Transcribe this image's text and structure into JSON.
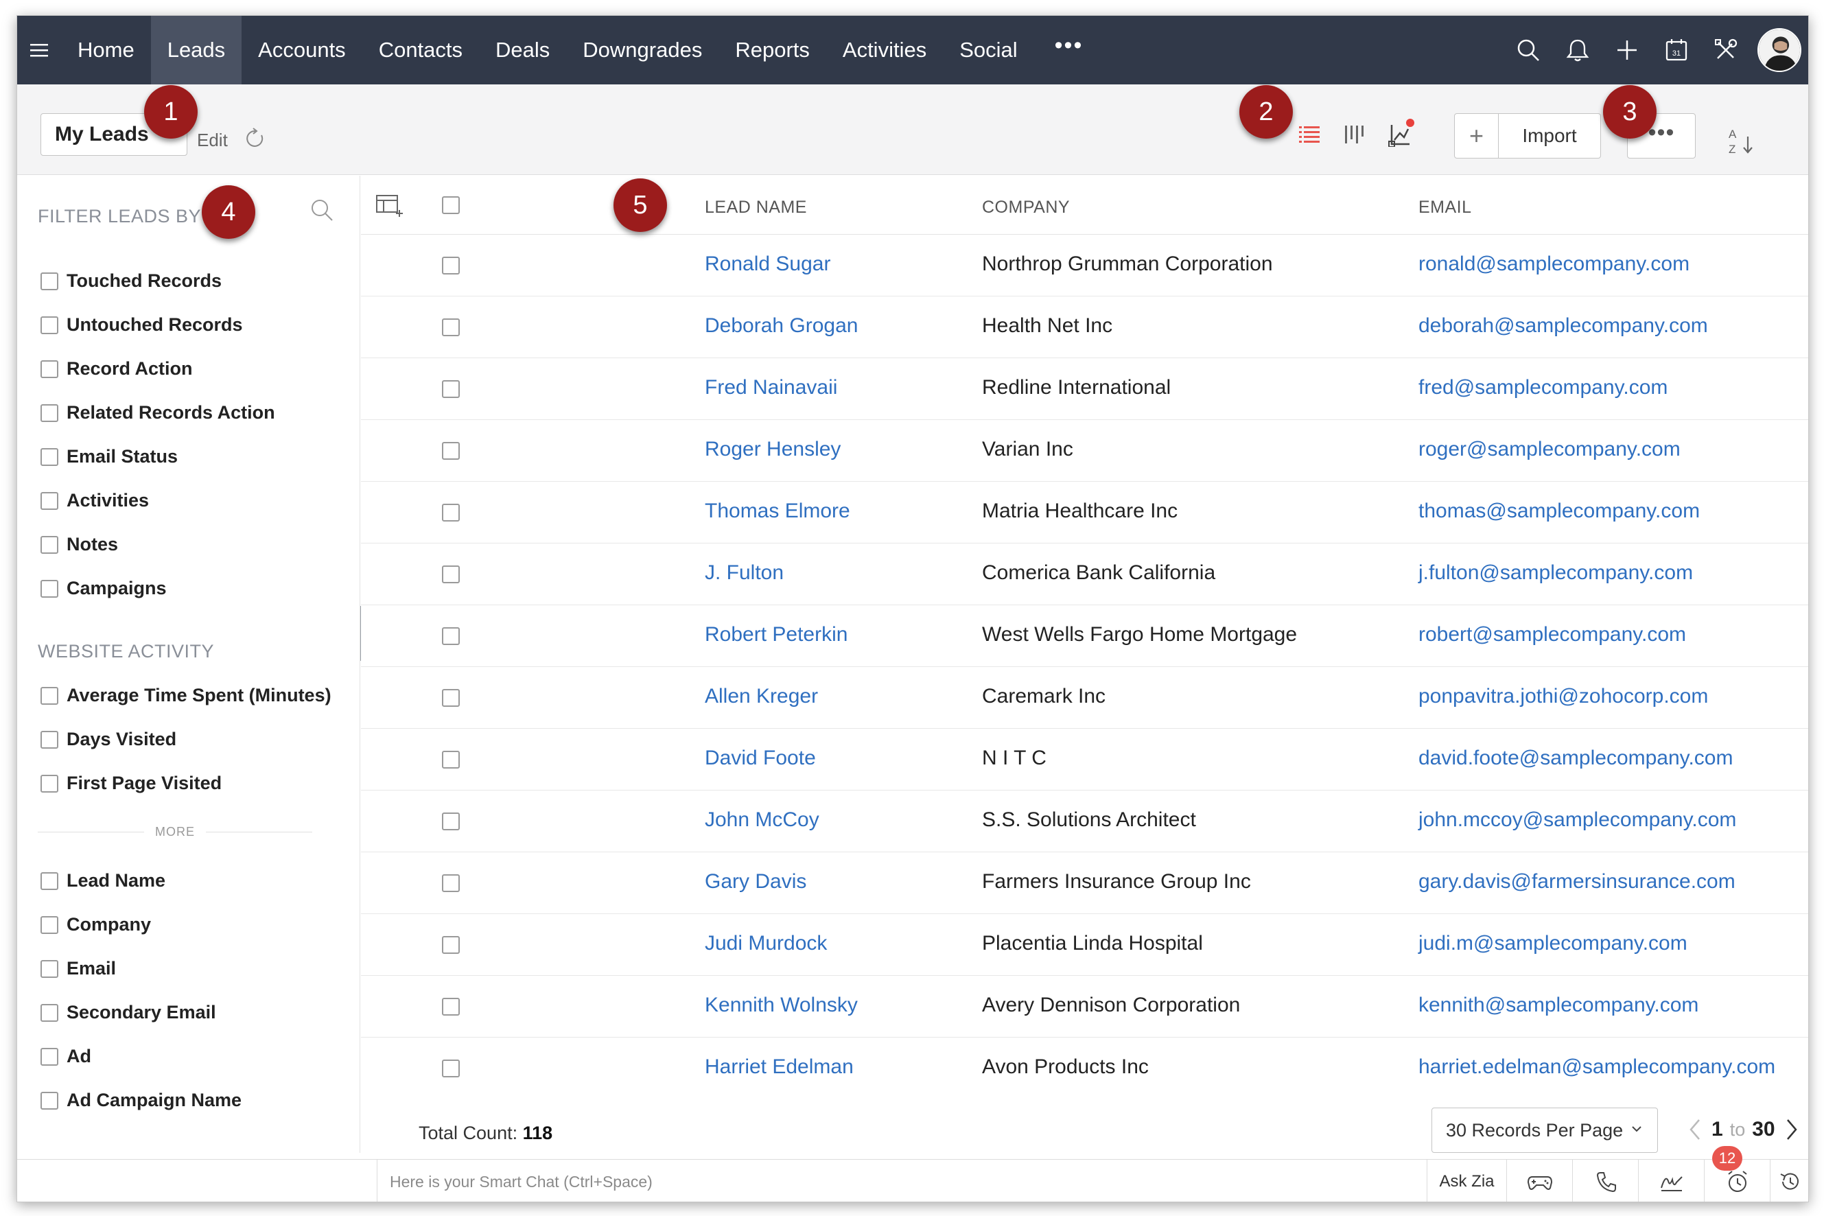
{
  "nav": {
    "items": [
      {
        "label": "Home",
        "active": false
      },
      {
        "label": "Leads",
        "active": true
      },
      {
        "label": "Accounts",
        "active": false
      },
      {
        "label": "Contacts",
        "active": false
      },
      {
        "label": "Deals",
        "active": false
      },
      {
        "label": "Downgrades",
        "active": false
      },
      {
        "label": "Reports",
        "active": false
      },
      {
        "label": "Activities",
        "active": false
      },
      {
        "label": "Social",
        "active": false
      }
    ],
    "more": "•••",
    "icons": [
      "search-icon",
      "bell-icon",
      "plus-icon",
      "calendar-icon",
      "tools-icon"
    ],
    "calendar_day": "31"
  },
  "toolbar": {
    "view_name": "My Leads",
    "edit_label": "Edit",
    "import_label": "Import",
    "plus_label": "+",
    "more_label": "•••",
    "sort_label_a": "A",
    "sort_label_z": "Z"
  },
  "sidebar": {
    "filter_heading": "FILTER LEADS BY",
    "system_filters": [
      "Touched Records",
      "Untouched Records",
      "Record Action",
      "Related Records Action",
      "Email Status",
      "Activities",
      "Notes",
      "Campaigns"
    ],
    "website_heading": "WEBSITE ACTIVITY",
    "website_filters": [
      "Average Time Spent (Minutes)",
      "Days Visited",
      "First Page Visited"
    ],
    "more_label": "MORE",
    "field_filters": [
      "Lead Name",
      "Company",
      "Email",
      "Secondary Email",
      "Ad",
      "Ad Campaign Name"
    ]
  },
  "table": {
    "columns": [
      "LEAD NAME",
      "COMPANY",
      "EMAIL"
    ],
    "rows": [
      {
        "name": "Ronald Sugar",
        "company": "Northrop Grumman Corporation",
        "email": "ronald@samplecompany.com"
      },
      {
        "name": "Deborah Grogan",
        "company": "Health Net Inc",
        "email": "deborah@samplecompany.com"
      },
      {
        "name": "Fred Nainavaii",
        "company": "Redline International",
        "email": "fred@samplecompany.com"
      },
      {
        "name": "Roger Hensley",
        "company": "Varian Inc",
        "email": "roger@samplecompany.com"
      },
      {
        "name": "Thomas Elmore",
        "company": "Matria Healthcare Inc",
        "email": "thomas@samplecompany.com"
      },
      {
        "name": "J. Fulton",
        "company": "Comerica Bank California",
        "email": "j.fulton@samplecompany.com"
      },
      {
        "name": "Robert Peterkin",
        "company": "West Wells Fargo Home Mortgage",
        "email": "robert@samplecompany.com"
      },
      {
        "name": "Allen Kreger",
        "company": "Caremark Inc",
        "email": "ponpavitra.jothi@zohocorp.com"
      },
      {
        "name": "David Foote",
        "company": "N I T C",
        "email": "david.foote@samplecompany.com"
      },
      {
        "name": "John McCoy",
        "company": "S.S. Solutions Architect",
        "email": "john.mccoy@samplecompany.com"
      },
      {
        "name": "Gary Davis",
        "company": "Farmers Insurance Group Inc",
        "email": "gary.davis@farmersinsurance.com"
      },
      {
        "name": "Judi Murdock",
        "company": "Placentia Linda Hospital",
        "email": "judi.m@samplecompany.com"
      },
      {
        "name": "Kennith Wolnsky",
        "company": "Avery Dennison Corporation",
        "email": "kennith@samplecompany.com"
      },
      {
        "name": "Harriet Edelman",
        "company": "Avon Products Inc",
        "email": "harriet.edelman@samplecompany.com"
      }
    ],
    "total_label": "Total Count:",
    "total_value": "118",
    "per_page": "30 Records Per Page",
    "page_from": "1",
    "page_to_label": "to",
    "page_to": "30"
  },
  "bottombar": {
    "smart_chat_placeholder": "Here is your Smart Chat (Ctrl+Space)",
    "ask_zia": "Ask Zia",
    "reminder_count": "12"
  },
  "callouts": [
    "1",
    "2",
    "3",
    "4",
    "5"
  ],
  "colors": {
    "nav_bg": "#313949",
    "nav_active": "#4a5263",
    "link": "#2f6fc0",
    "callout": "#9b1c1c",
    "list_view_active": "#e8554e"
  }
}
